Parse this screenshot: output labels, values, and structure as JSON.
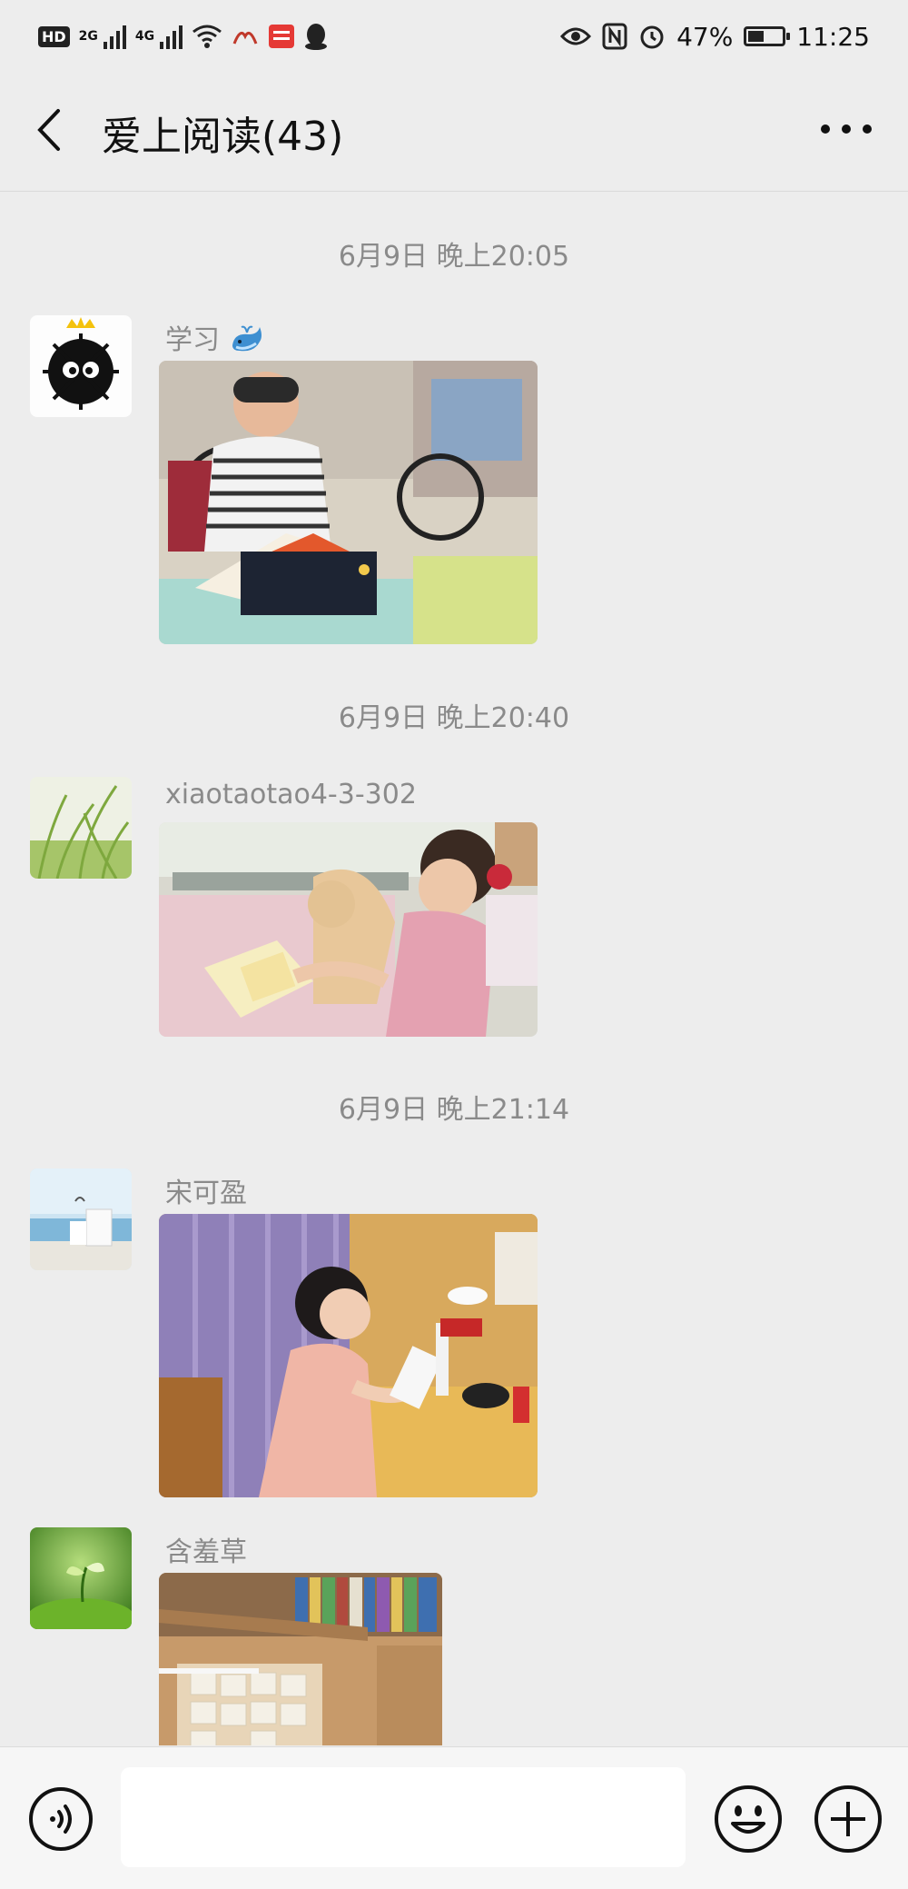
{
  "status_bar": {
    "hd_label": "HD",
    "net_2g": "2G",
    "net_4g": "4G",
    "battery_text": "47%",
    "battery_level": 0.47,
    "time": "11:25"
  },
  "header": {
    "title": "爱上阅读(43)"
  },
  "messages": [
    {
      "timestamp": "6月9日 晚上20:05",
      "sender": "学习",
      "avatar": "black-furball-avatar",
      "photo": "boy-reading-book-photo"
    },
    {
      "timestamp": "6月9日 晚上20:40",
      "sender": "xiaotaotao4-3-302",
      "avatar": "grass-avatar",
      "photo": "girl-reading-on-sofa-photo"
    },
    {
      "timestamp": "6月9日 晚上21:14",
      "sender": "宋可盈",
      "avatar": "seaside-chair-avatar",
      "photo": "girl-reading-at-desk-photo"
    },
    {
      "timestamp": "",
      "sender": "含羞草",
      "avatar": "sprout-avatar",
      "photo": "study-room-bookshelf-photo"
    }
  ],
  "input_bar": {
    "placeholder": ""
  },
  "colors": {
    "background": "#ededed",
    "meta_text": "#8a8a8a",
    "title_text": "#111111"
  }
}
